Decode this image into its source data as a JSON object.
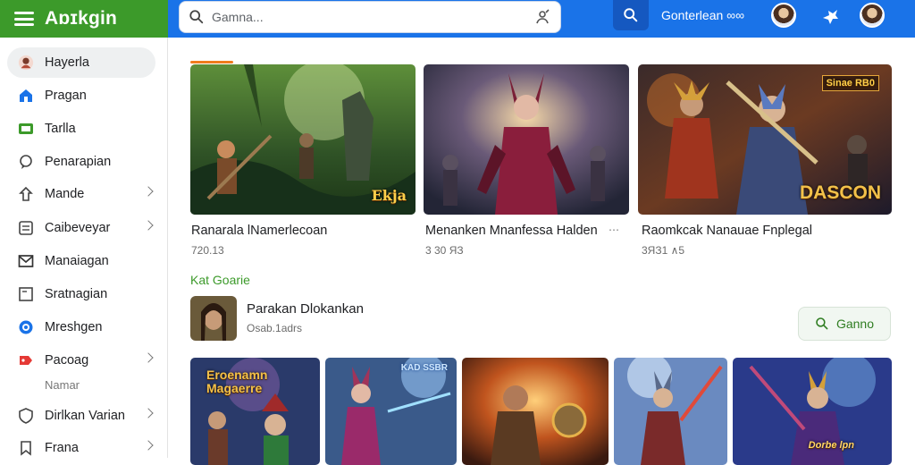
{
  "app": {
    "title": "Aɒɪkgin"
  },
  "search": {
    "placeholder": "Gamna..."
  },
  "topnav": {
    "link": "Gonterlean ∞∞"
  },
  "sidebar": {
    "items": [
      {
        "label": "Hayerla",
        "icon": "avatar"
      },
      {
        "label": "Pragan",
        "icon": "home-icon"
      },
      {
        "label": "Tarlla",
        "icon": "tv-icon"
      },
      {
        "label": "Penarapian",
        "icon": "chat-icon"
      },
      {
        "label": "Mande",
        "icon": "upload-icon"
      },
      {
        "label": "Caibeveyar",
        "icon": "list-icon"
      },
      {
        "label": "Manaiagan",
        "icon": "mail-icon"
      },
      {
        "label": "Sratnagian",
        "icon": "window-icon"
      },
      {
        "label": "Mreshgen",
        "icon": "circle-icon"
      },
      {
        "label": "Pacoag",
        "icon": "tag-icon"
      },
      {
        "label": "Dirlkan Varian",
        "icon": "shield-icon"
      },
      {
        "label": "Frana",
        "icon": "bookmark-icon"
      }
    ],
    "sub_label": "Namar"
  },
  "heroes": [
    {
      "title": "Ranarala lNamerlecoan",
      "meta": "720.13",
      "badge": "Ekja"
    },
    {
      "title": "Menanken Mnanfessa Halden",
      "meta": "3 30 ЯЗ",
      "more": "⋯"
    },
    {
      "title": "Raomkcak Nanauae Fnplegal",
      "meta": "3ЯЗ1 ∧5",
      "badge": "DASCON",
      "corner_badge": "Sinae RB0"
    }
  ],
  "section": {
    "title": "Kat Goarie"
  },
  "recommendation": {
    "title": "Parakan Dlokankan",
    "subtitle": "Osab.1adrs",
    "button": "Ganno"
  },
  "tiles": [
    {
      "badge": "Eroenamn Magaerre"
    },
    {
      "badge": "KAD SSBR"
    },
    {
      "badge": ""
    },
    {
      "badge": ""
    },
    {
      "badge": "Dorbe lpn"
    }
  ],
  "colors": {
    "green": "#3c9a2a",
    "blue": "#1a73e8",
    "accent": "#f07c1d"
  }
}
